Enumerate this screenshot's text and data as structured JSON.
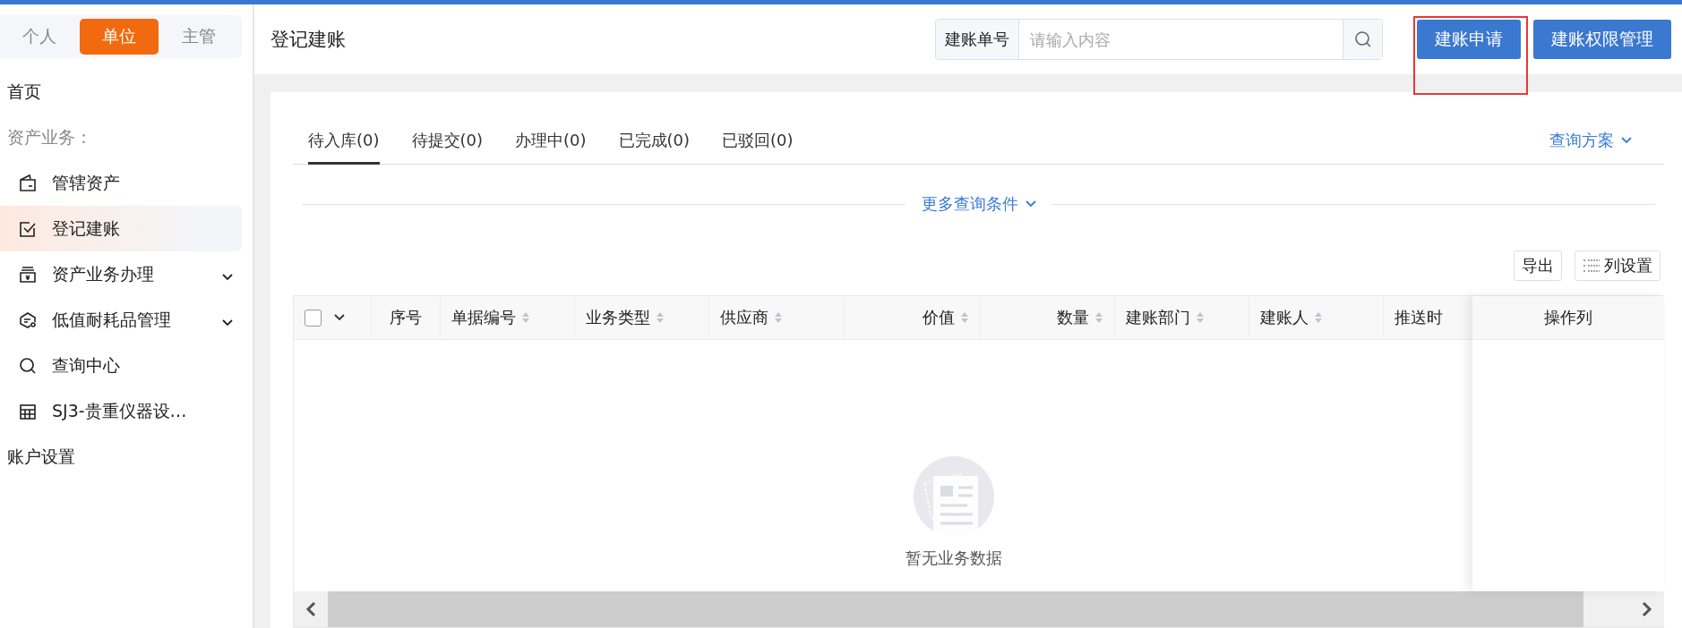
{
  "role_tabs": [
    {
      "label": "个人",
      "selected": false
    },
    {
      "label": "单位",
      "selected": true
    },
    {
      "label": "主管",
      "selected": false
    }
  ],
  "sidebar": {
    "items": [
      {
        "kind": "link",
        "label": "首页",
        "selected": false
      },
      {
        "kind": "section",
        "label": "资产业务："
      },
      {
        "kind": "item",
        "label": "管辖资产",
        "selected": false
      },
      {
        "kind": "item",
        "label": "登记建账",
        "selected": true
      },
      {
        "kind": "group",
        "label": "资产业务办理",
        "selected": false,
        "expanded": false
      },
      {
        "kind": "group",
        "label": "低值耐耗品管理",
        "selected": false,
        "expanded": false
      },
      {
        "kind": "item",
        "label": "查询中心",
        "selected": false
      },
      {
        "kind": "item",
        "label": "SJ3-贵重仪器设…",
        "selected": false
      },
      {
        "kind": "link",
        "label": "账户设置",
        "selected": false
      }
    ]
  },
  "header": {
    "title": "登记建账",
    "search": {
      "label": "建账单号",
      "placeholder": "请输入内容"
    },
    "buttons": [
      {
        "label": "建账申请",
        "highlighted": true
      },
      {
        "label": "建账权限管理",
        "highlighted": false
      }
    ]
  },
  "status_tabs": [
    {
      "label": "待入库(0)",
      "selected": true
    },
    {
      "label": "待提交(0)",
      "selected": false
    },
    {
      "label": "办理中(0)",
      "selected": false
    },
    {
      "label": "已完成(0)",
      "selected": false
    },
    {
      "label": "已驳回(0)",
      "selected": false
    }
  ],
  "query_scheme": "查询方案",
  "more_conditions": "更多查询条件",
  "toolbar": [
    {
      "kind": "plain",
      "label": "导出"
    },
    {
      "kind": "columns",
      "label": "列设置"
    }
  ],
  "table": {
    "select_all": {
      "checked": false
    },
    "columns": [
      {
        "kind": "index",
        "label": "序号",
        "sortable": false
      },
      {
        "kind": "text",
        "label": "单据编号",
        "sortable": true
      },
      {
        "kind": "text",
        "label": "业务类型",
        "sortable": true
      },
      {
        "kind": "text",
        "label": "供应商",
        "sortable": true
      },
      {
        "kind": "number",
        "label": "价值",
        "sortable": true
      },
      {
        "kind": "number",
        "label": "数量",
        "sortable": true
      },
      {
        "kind": "text",
        "label": "建账部门",
        "sortable": true
      },
      {
        "kind": "text",
        "label": "建账人",
        "sortable": true
      },
      {
        "kind": "text",
        "label": "推送时",
        "sortable": false
      }
    ],
    "fixed_column": "操作列",
    "empty_text": "暂无业务数据"
  }
}
